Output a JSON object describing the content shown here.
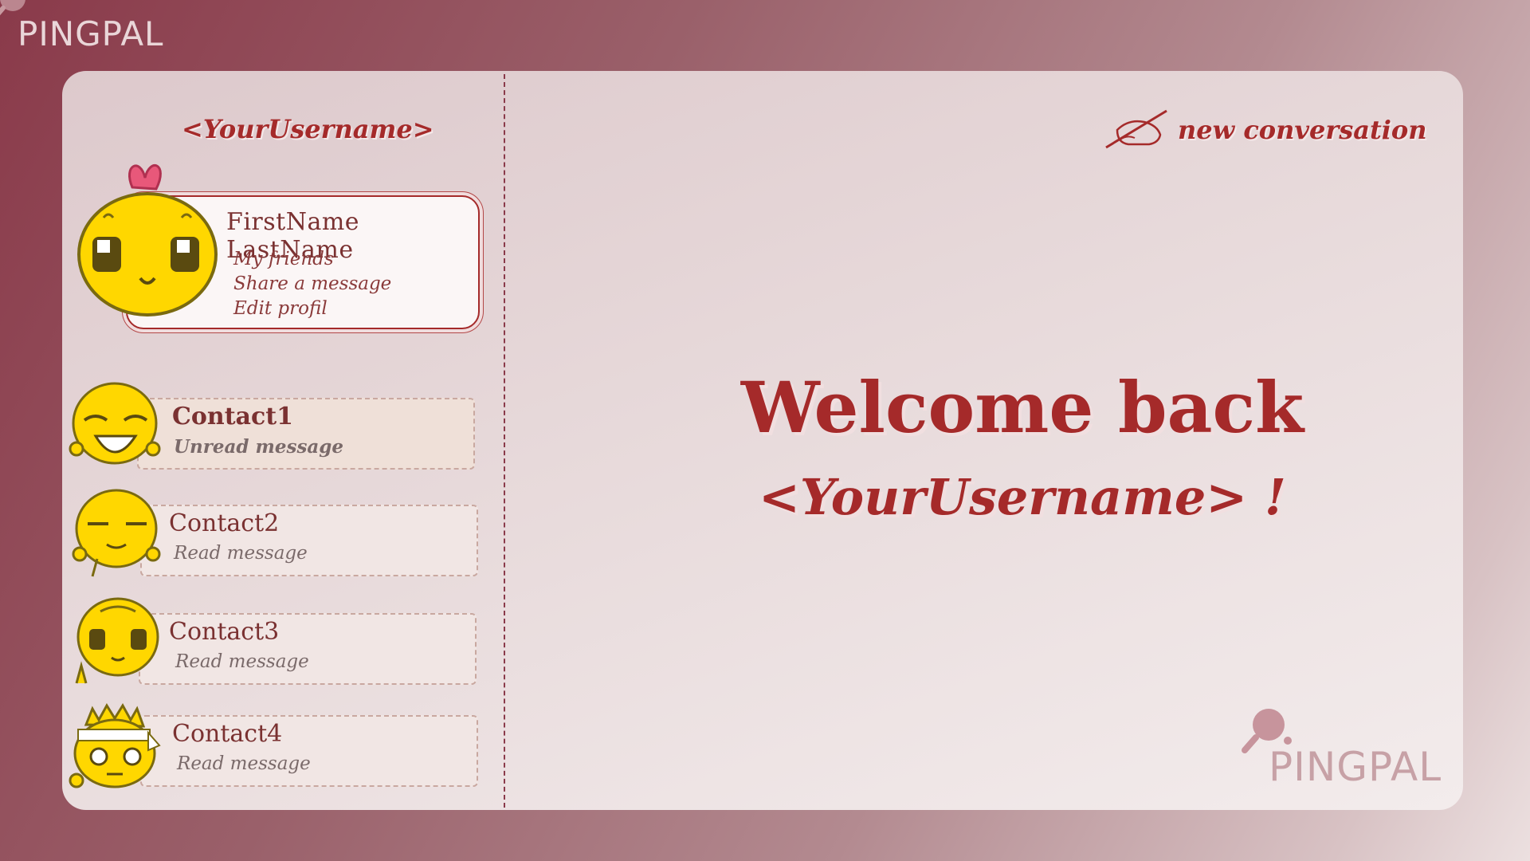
{
  "app": {
    "logo_text": "PINGPAL"
  },
  "sidebar": {
    "username": "<YourUsername>",
    "profile": {
      "full_name": "FirstName LastName",
      "links": [
        "My friends",
        "Share a message",
        "Edit profil"
      ]
    },
    "contacts": [
      {
        "name": "Contact1",
        "status": "Unread message"
      },
      {
        "name": "Contact2",
        "status": "Read message"
      },
      {
        "name": "Contact3",
        "status": "Read message"
      },
      {
        "name": "Contact4",
        "status": "Read message"
      }
    ]
  },
  "main": {
    "new_conversation_label": "new conversation",
    "welcome_line1": "Welcome back",
    "welcome_line2": "<YourUsername> !"
  },
  "colors": {
    "accent": "#a52a2a",
    "avatar_yellow": "#ffd700",
    "bow_pink": "#e8587a"
  },
  "icons": {
    "new_conversation": "pen-writing-icon",
    "logo": "ping-pong-paddle-icon"
  }
}
